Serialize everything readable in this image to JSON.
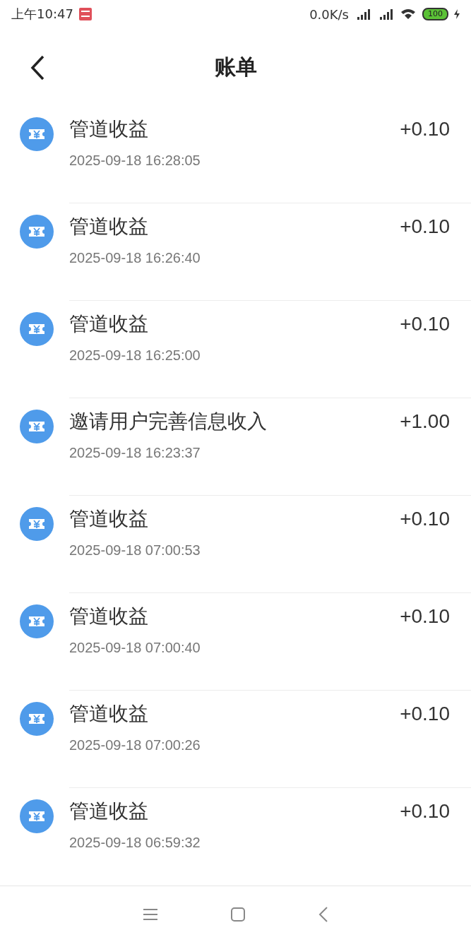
{
  "status_bar": {
    "time": "上午10:47",
    "speed": "0.0K/s",
    "battery": "100"
  },
  "header": {
    "title": "账单"
  },
  "bills": [
    {
      "title": "管道收益",
      "time": "2025-09-18 16:28:05",
      "amount": "+0.10"
    },
    {
      "title": "管道收益",
      "time": "2025-09-18 16:26:40",
      "amount": "+0.10"
    },
    {
      "title": "管道收益",
      "time": "2025-09-18 16:25:00",
      "amount": "+0.10"
    },
    {
      "title": "邀请用户完善信息收入",
      "time": "2025-09-18 16:23:37",
      "amount": "+1.00"
    },
    {
      "title": "管道收益",
      "time": "2025-09-18 07:00:53",
      "amount": "+0.10"
    },
    {
      "title": "管道收益",
      "time": "2025-09-18 07:00:40",
      "amount": "+0.10"
    },
    {
      "title": "管道收益",
      "time": "2025-09-18 07:00:26",
      "amount": "+0.10"
    },
    {
      "title": "管道收益",
      "time": "2025-09-18 06:59:32",
      "amount": "+0.10"
    }
  ]
}
